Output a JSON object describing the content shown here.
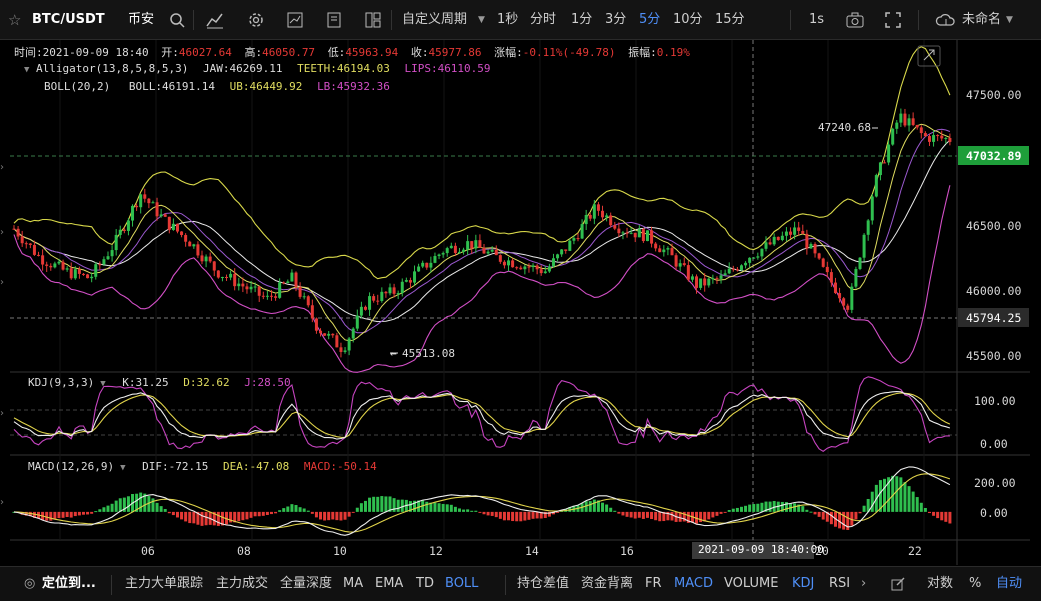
{
  "toolbar": {
    "pair": "BTC/USDT",
    "exchange": "币安",
    "period_menu": "自定义周期",
    "intervals": [
      "1秒",
      "分时",
      "1分",
      "3分",
      "5分",
      "10分",
      "15分"
    ],
    "active_interval": "5分",
    "replay": "1s",
    "layout_name": "未命名"
  },
  "info": {
    "time_label": "时间:",
    "time": "2021-09-09 18:40",
    "open_label": "开:",
    "open": "46027.64",
    "high_label": "高:",
    "high": "46050.77",
    "low_label": "低:",
    "low": "45963.94",
    "close_label": "收:",
    "close": "45977.86",
    "change_label": "涨幅:",
    "change": "-0.11%(-49.78)",
    "amp_label": "振幅:",
    "amp": "0.19%"
  },
  "alligator": {
    "name": "Alligator(13,8,5,8,5,3)",
    "jaw": "JAW:46269.11",
    "teeth": "TEETH:46194.03",
    "lips": "LIPS:46110.59"
  },
  "boll": {
    "name": "BOLL(20,2)",
    "boll": "BOLL:46191.14",
    "ub": "UB:46449.92",
    "lb": "LB:45932.36"
  },
  "kdj": {
    "name": "KDJ(9,3,3)",
    "k": "K:31.25",
    "d": "D:32.62",
    "j": "J:28.50"
  },
  "macd": {
    "name": "MACD(12,26,9)",
    "dif": "DIF:-72.15",
    "dea": "DEA:-47.08",
    "macd": "MACD:-50.14"
  },
  "price_axis": [
    "47500.00",
    "46500.00",
    "46000.00",
    "45500.00"
  ],
  "last_price": "47032.89",
  "cross_price": "45794.25",
  "kdj_axis": [
    "100.00",
    "0.00"
  ],
  "macd_axis": [
    "200.00",
    "0.00"
  ],
  "max_label": "47240.68",
  "min_label": "45513.08",
  "time_axis": [
    "06",
    "08",
    "10",
    "12",
    "14",
    "16",
    "20",
    "22"
  ],
  "cross_time": "2021-09-09 18:40:00",
  "bottom": {
    "locate": "定位到...",
    "items": [
      "主力大单跟踪",
      "主力成交",
      "全量深度",
      "MA",
      "EMA",
      "TD",
      "BOLL",
      "持仓差值",
      "资金背离",
      "FR",
      "MACD",
      "VOLUME",
      "KDJ",
      "RSI"
    ],
    "active_items": [
      "BOLL",
      "MACD",
      "KDJ"
    ],
    "right": [
      "对数",
      "%",
      "自动"
    ]
  },
  "colors": {
    "up": "#2fbf4f",
    "down": "#e53935",
    "boll_ub": "#d8d84a",
    "boll_lb": "#d24fc6",
    "accent": "#4f8ff7",
    "last_price_bg": "#1e9e3a"
  },
  "chart_data": {
    "type": "candlestick",
    "title": "BTC/USDT 币安 5分",
    "price_range": [
      45400,
      47700
    ],
    "series": [
      {
        "name": "close",
        "approx_values": [
          46400,
          46200,
          46100,
          46050,
          46300,
          46650,
          46450,
          46300,
          46100,
          46000,
          45900,
          46050,
          45700,
          45550,
          45900,
          45950,
          46100,
          46250,
          46300,
          46200,
          46150,
          46100,
          46300,
          46550,
          46400,
          46350,
          46200,
          46000,
          46050,
          46200,
          46300,
          46400,
          46100,
          45850,
          46700,
          47200,
          47050,
          47032.89
        ]
      }
    ],
    "annotations": {
      "high": 47240.68,
      "low": 45513.08
    },
    "kdj_range": [
      -20,
      120
    ],
    "macd_range": [
      -150,
      280
    ]
  }
}
